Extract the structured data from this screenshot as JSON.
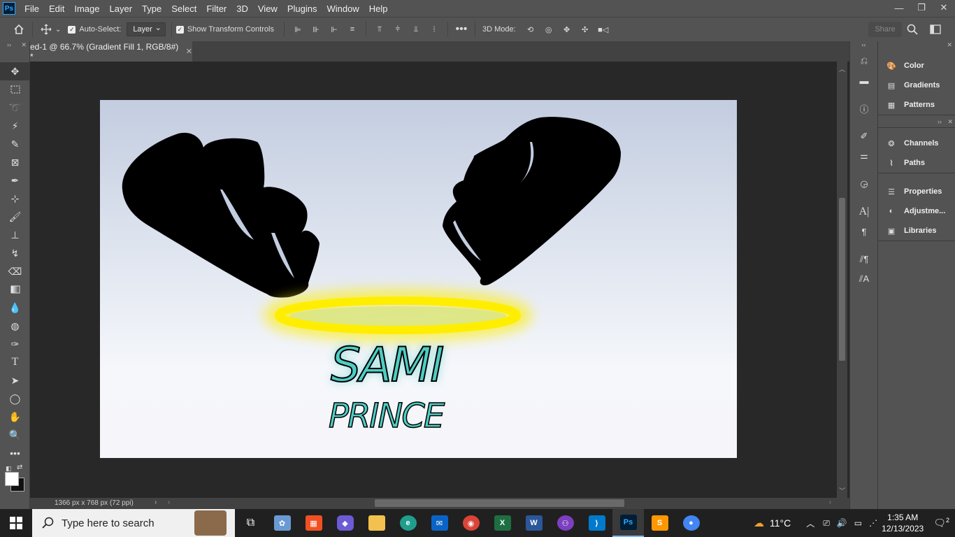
{
  "menu": {
    "app_icon": "Ps",
    "items": [
      "File",
      "Edit",
      "Image",
      "Layer",
      "Type",
      "Select",
      "Filter",
      "3D",
      "View",
      "Plugins",
      "Window",
      "Help"
    ]
  },
  "options": {
    "auto_select_label": "Auto-Select:",
    "auto_select_value": "Layer",
    "show_transform_label": "Show Transform Controls",
    "mode_3d_label": "3D Mode:",
    "share_label": "Share"
  },
  "document": {
    "tab_title": "ed-1 @ 66.7% (Gradient Fill 1, RGB/8#) *",
    "status_text": "1366 px x 768 px (72 ppi)"
  },
  "artwork": {
    "title_line1": "SAMI",
    "title_line2": "PRINCE",
    "halo_color": "#ffee00",
    "text_color": "#4ecdc4"
  },
  "panels": {
    "group1": [
      "Color",
      "Gradients",
      "Patterns"
    ],
    "group2": [
      "Channels",
      "Paths"
    ],
    "group3": [
      "Properties",
      "Adjustme...",
      "Libraries"
    ]
  },
  "taskbar": {
    "search_placeholder": "Type here to search",
    "weather": "11°C",
    "time": "1:35 AM",
    "date": "12/13/2023",
    "notification_count": "2"
  }
}
